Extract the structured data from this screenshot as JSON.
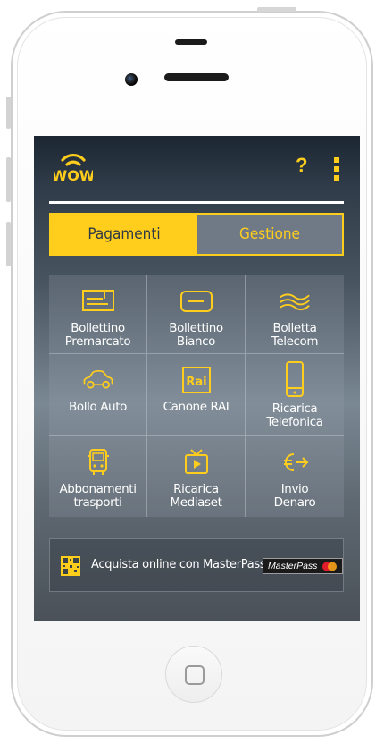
{
  "header": {
    "logo": "WOW",
    "help_label": "?",
    "menu_icon": "vertical-dots-icon"
  },
  "colors": {
    "accent": "#ffcd1c",
    "screen_dark": "#1c2633",
    "tab_inactive_bg": "#6f7a86"
  },
  "tabs": [
    {
      "label": "Pagamenti",
      "active": true
    },
    {
      "label": "Gestione",
      "active": false
    }
  ],
  "services": [
    {
      "line1": "Bollettino",
      "line2": "Premarcato",
      "icon": "prefilled-slip-icon"
    },
    {
      "line1": "Bollettino",
      "line2": "Bianco",
      "icon": "blank-slip-icon"
    },
    {
      "line1": "Bolletta",
      "line2": "Telecom",
      "icon": "telecom-waves-icon"
    },
    {
      "line1": "Bollo Auto",
      "line2": "",
      "icon": "car-icon"
    },
    {
      "line1": "Canone RAI",
      "line2": "",
      "icon": "rai-logo-icon",
      "icon_text": "Rai"
    },
    {
      "line1": "Ricarica",
      "line2": "Telefonica",
      "icon": "phone-icon"
    },
    {
      "line1": "Abbonamenti",
      "line2": "trasporti",
      "icon": "bus-icon"
    },
    {
      "line1": "Ricarica",
      "line2": "Mediaset",
      "icon": "tv-icon"
    },
    {
      "line1": "Invio",
      "line2": "Denaro",
      "icon": "euro-transfer-icon"
    }
  ],
  "masterpass": {
    "text": "Acquista online con MasterPass",
    "badge_label": "MasterPass",
    "qr_icon": "qr-code-icon"
  }
}
